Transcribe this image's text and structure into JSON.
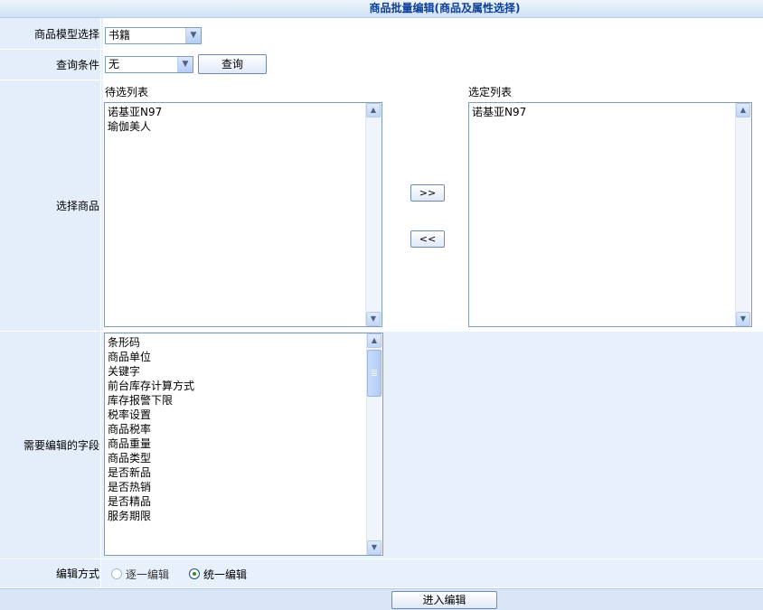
{
  "page_title": "商品批量编辑(商品及属性选择)",
  "model_row": {
    "label": "商品模型选择",
    "selected": "书籍"
  },
  "query_row": {
    "label": "查询条件",
    "selected": "无",
    "button": "查询"
  },
  "goods_row": {
    "label": "选择商品",
    "available_caption": "待选列表",
    "selected_caption": "选定列表",
    "available_items": [
      "诺基亚N97",
      "瑜伽美人"
    ],
    "selected_items": [
      "诺基亚N97"
    ],
    "add_button": ">>",
    "remove_button": "<<"
  },
  "fields_row": {
    "label": "需要编辑的字段",
    "items": [
      "条形码",
      "商品单位",
      "关键字",
      "前台库存计算方式",
      "库存报警下限",
      "税率设置",
      "商品税率",
      "商品重量",
      "商品类型",
      "是否新品",
      "是否热销",
      "是否精品",
      "服务期限"
    ]
  },
  "mode_row": {
    "label": "编辑方式",
    "option_one_by_one": "逐一编辑",
    "option_unified": "统一编辑",
    "selected": "统一编辑"
  },
  "footer": {
    "submit_button": "进入编辑"
  }
}
